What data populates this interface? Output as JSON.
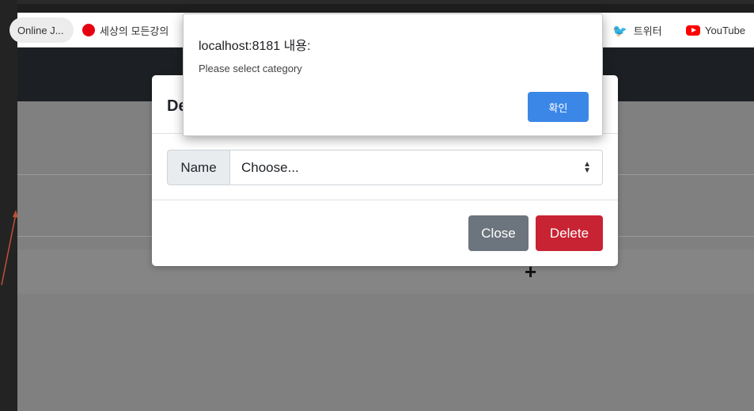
{
  "bookmarks": [
    {
      "label": "Online J...",
      "icon": "bookmark-page-icon"
    },
    {
      "label": "세상의 모든강의",
      "icon": "red-d-logo-icon"
    },
    {
      "label": "트위터",
      "icon": "twitter-icon"
    },
    {
      "label": "YouTube",
      "icon": "youtube-icon"
    }
  ],
  "modal": {
    "title_partial": "De",
    "name_label": "Name",
    "select_value": "Choose...",
    "close_label": "Close",
    "delete_label": "Delete"
  },
  "alert": {
    "title": "localhost:8181 내용:",
    "message": "Please select category",
    "ok_label": "확인"
  },
  "colors": {
    "close_button": "#6c757d",
    "delete_button": "#c82333",
    "alert_ok": "#3b87e8",
    "navbar": "#1c1f23"
  }
}
